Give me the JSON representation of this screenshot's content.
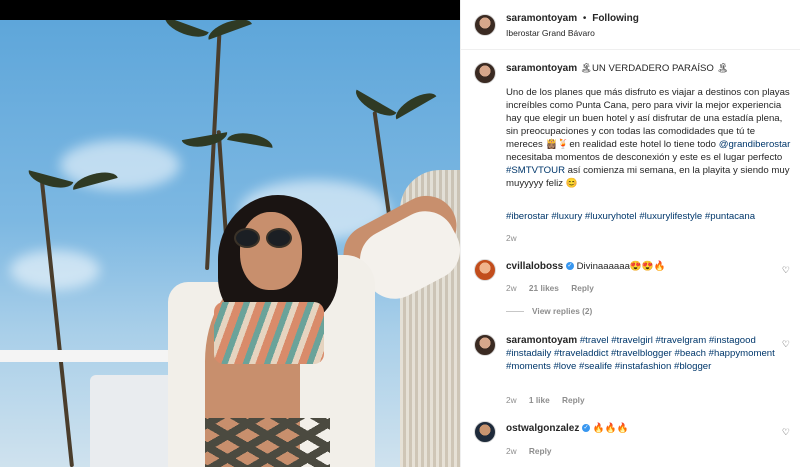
{
  "post": {
    "author": "saramontoyam",
    "follow_label": "Following",
    "location": "Iberostar Grand Bávaro",
    "caption_title": "🏝UN VERDADERO PARAÍSO 🏝",
    "caption_text_1": "Uno de los planes que más disfruto es viajar a destinos con playas increíbles como Punta Cana, pero para vivir la mejor experiencia hay que elegir un buen hotel y así disfrutar de una estadía plena, sin preocupaciones y con todas las comodidades que tú te mereces 👸🏽🍹en realidad este hotel lo tiene todo ",
    "mention": "@grandiberostar",
    "caption_text_2": " necesitaba momentos de desconexión y este es el lugar perfecto ",
    "hashtag_tour": "#SMTVTOUR",
    "caption_text_3": " así comienza mi semana, en la playita y siendo muy muyyyyy feliz 😊",
    "hashtags": "#iberostar #luxury #luxuryhotel #luxurylifestyle #puntacana",
    "time": "2w"
  },
  "comments": [
    {
      "user": "cvillaloboss",
      "text": "Divinaaaaaa😍😍🔥",
      "time": "2w",
      "likes": "21 likes",
      "reply": "Reply",
      "view_replies": "View replies (2)"
    },
    {
      "user": "saramontoyam",
      "text": "#travel #travelgirl #travelgram #instagood #instadaily #traveladdict #travelblogger #beach #happymoment #moments #love #sealife #instafashion #blogger",
      "time": "2w",
      "likes": "1 like",
      "reply": "Reply"
    },
    {
      "user": "ostwalgonzalez",
      "text": "🔥🔥🔥",
      "time": "2w",
      "reply": "Reply"
    }
  ],
  "icons": {
    "verified": "✓",
    "heart": "♡",
    "dot": "•"
  }
}
